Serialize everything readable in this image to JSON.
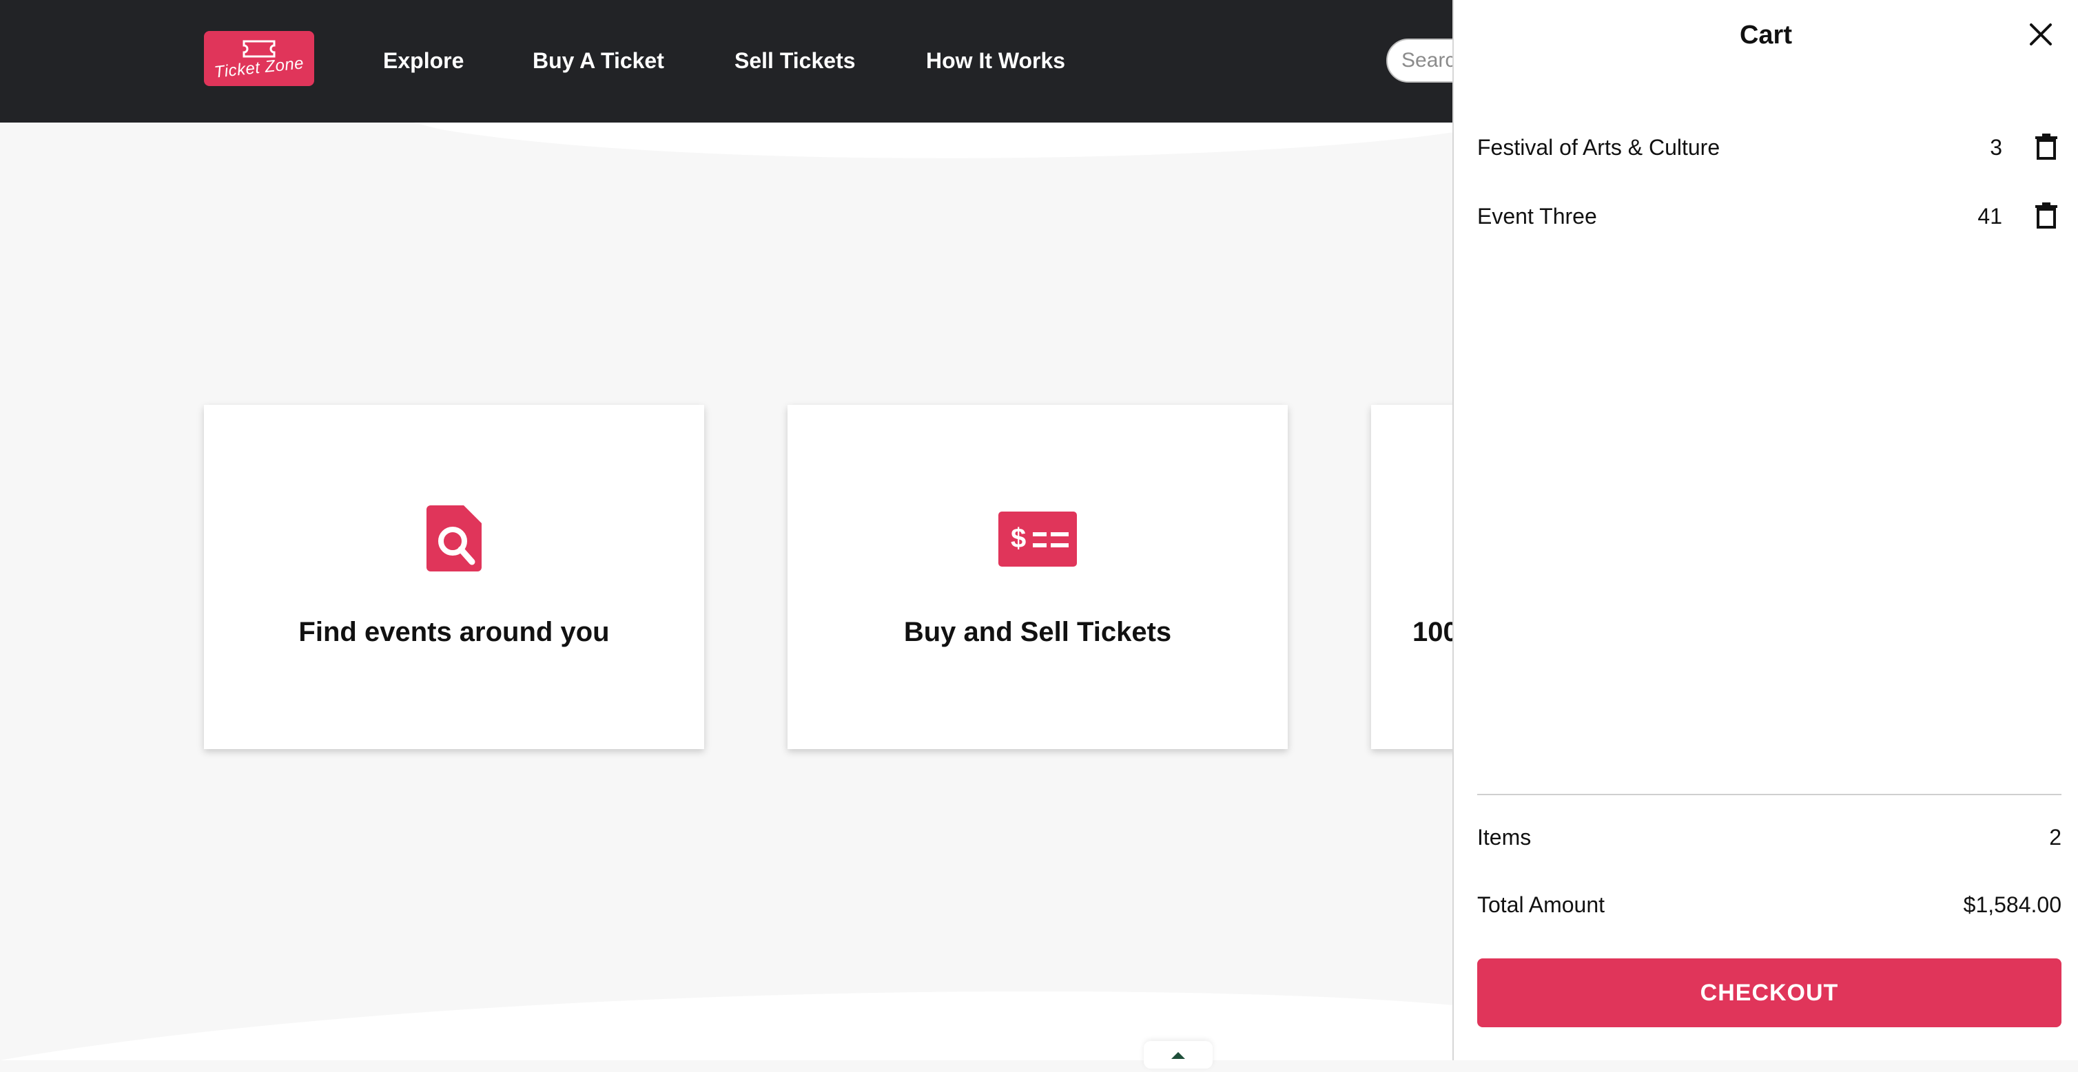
{
  "header": {
    "logo_text": "Ticket Zone",
    "nav": [
      "Explore",
      "Buy A Ticket",
      "Sell Tickets",
      "How It Works"
    ],
    "search_placeholder": "Search"
  },
  "features": [
    {
      "title": "Find events around you",
      "icon": "search-document-icon"
    },
    {
      "title": "Buy and Sell Tickets",
      "icon": "money-check-icon"
    },
    {
      "title": "100",
      "icon": ""
    }
  ],
  "cart": {
    "title": "Cart",
    "items": [
      {
        "name": "Festival of Arts & Culture",
        "quantity": "3"
      },
      {
        "name": "Event Three",
        "quantity": "41"
      }
    ],
    "items_label": "Items",
    "items_count": "2",
    "total_label": "Total Amount",
    "total_value": "$1,584.00",
    "checkout_label": "CHECKOUT"
  },
  "colors": {
    "accent": "#e0355a",
    "nav_background": "#222326",
    "page_background": "#f7f7f7"
  }
}
